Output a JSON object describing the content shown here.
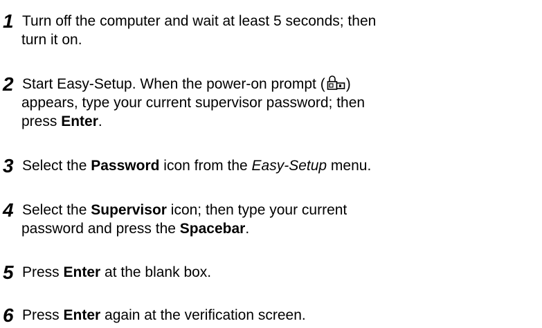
{
  "steps": [
    {
      "number": "1",
      "line1": "Turn off the computer and wait at least 5 seconds; then",
      "line2": "turn it on."
    },
    {
      "number": "2",
      "line1_a": "Start Easy-Setup.  When the power-on prompt (",
      "line1_b": ")",
      "icon": "power-on-prompt-icon",
      "line2": "appears, type your current supervisor password; then",
      "line3_a": "press ",
      "line3_b": "Enter",
      "line3_c": "."
    },
    {
      "number": "3",
      "a": "Select the ",
      "b": "Password",
      "c": " icon from the ",
      "d": "Easy-Setup",
      "e": " menu."
    },
    {
      "number": "4",
      "line1_a": "Select the ",
      "line1_b": "Supervisor",
      "line1_c": " icon; then type your current",
      "line2_a": "password and press the ",
      "line2_b": "Spacebar",
      "line2_c": "."
    },
    {
      "number": "5",
      "a": "Press ",
      "b": "Enter",
      "c": " at the blank box."
    },
    {
      "number": "6",
      "a": "Press ",
      "b": "Enter",
      "c": " again at the verification screen."
    }
  ]
}
